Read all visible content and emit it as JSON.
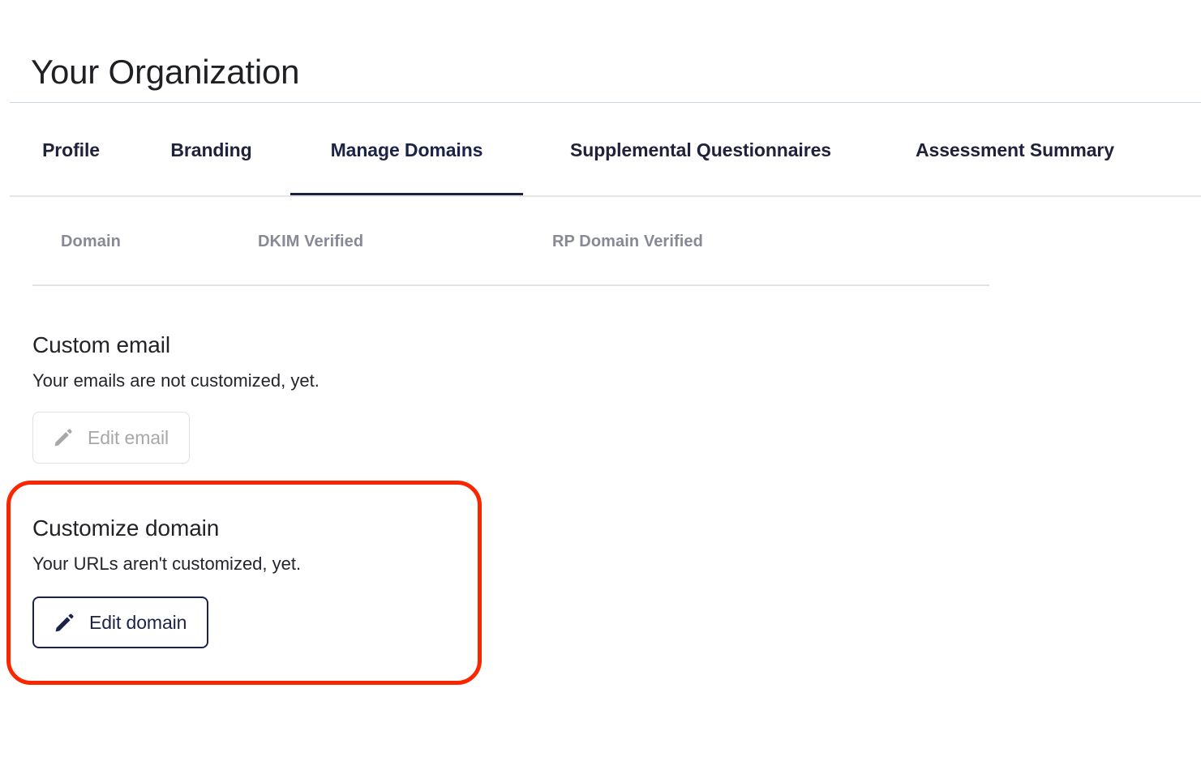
{
  "header": {
    "title": "Your Organization"
  },
  "tabs": [
    {
      "label": "Profile",
      "active": false,
      "name": "tab-profile"
    },
    {
      "label": "Branding",
      "active": false,
      "name": "tab-branding"
    },
    {
      "label": "Manage Domains",
      "active": true,
      "name": "tab-manage-domains"
    },
    {
      "label": "Supplemental Questionnaires",
      "active": false,
      "name": "tab-supplemental-questionnaires"
    },
    {
      "label": "Assessment Summary",
      "active": false,
      "name": "tab-assessment-summary"
    }
  ],
  "domain_table": {
    "columns": [
      "Domain",
      "DKIM Verified",
      "RP Domain Verified"
    ],
    "rows": []
  },
  "custom_email": {
    "title": "Custom email",
    "description": "Your emails are not customized, yet.",
    "button_label": "Edit email",
    "button_icon": "pencil-icon",
    "button_enabled": false
  },
  "customize_domain": {
    "title": "Customize domain",
    "description": "Your URLs aren't customized, yet.",
    "button_label": "Edit domain",
    "button_icon": "pencil-icon",
    "button_enabled": true
  },
  "annotation": {
    "color": "#fa2600",
    "target": "customize-domain-section"
  },
  "colors": {
    "accent_navy": "#1b2349",
    "header_divider": "#ccd6e4",
    "muted_text": "#878995",
    "disabled_text": "#a8a8a8",
    "annotation_red": "#fa2600"
  }
}
